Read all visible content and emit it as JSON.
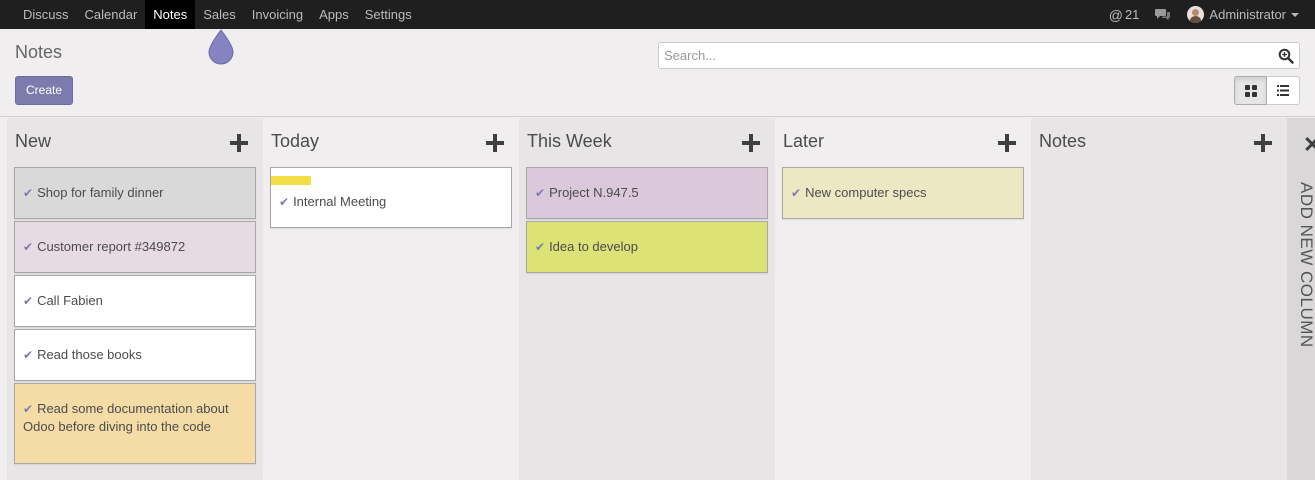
{
  "navbar": {
    "menu": [
      "Discuss",
      "Calendar",
      "Notes",
      "Sales",
      "Invoicing",
      "Apps",
      "Settings"
    ],
    "active": "Notes",
    "mentions_count": "21",
    "user": "Administrator"
  },
  "control_panel": {
    "title": "Notes",
    "create_label": "Create",
    "search_placeholder": "Search..."
  },
  "kanban": {
    "columns": [
      {
        "title": "New",
        "cards": [
          {
            "text": "Shop for family dinner",
            "color": "#d9d9d9"
          },
          {
            "text": "Customer report #349872",
            "color": "#e6dbe2"
          },
          {
            "text": "Call Fabien",
            "color": "#ffffff"
          },
          {
            "text": "Read those books",
            "color": "#ffffff"
          },
          {
            "text": "Read some documentation about Odoo before diving into the code",
            "color": "#f5dca6"
          }
        ]
      },
      {
        "title": "Today",
        "cards": [
          {
            "text": "Internal Meeting",
            "color": "#ffffff",
            "tag_color": "#f4de45"
          }
        ]
      },
      {
        "title": "This Week",
        "cards": [
          {
            "text": "Project N.947.5",
            "color": "#dbc8da"
          },
          {
            "text": "Idea to develop",
            "color": "#dce276"
          }
        ]
      },
      {
        "title": "Later",
        "cards": [
          {
            "text": "New computer specs",
            "color": "#ede8c4"
          }
        ]
      },
      {
        "title": "Notes",
        "cards": []
      }
    ],
    "add_column_label": "ADD NEW COLUMN"
  },
  "colors": {
    "navbar_bg": "#1f1f1f",
    "accent": "#7c7bad",
    "check": "#7c7bad"
  }
}
